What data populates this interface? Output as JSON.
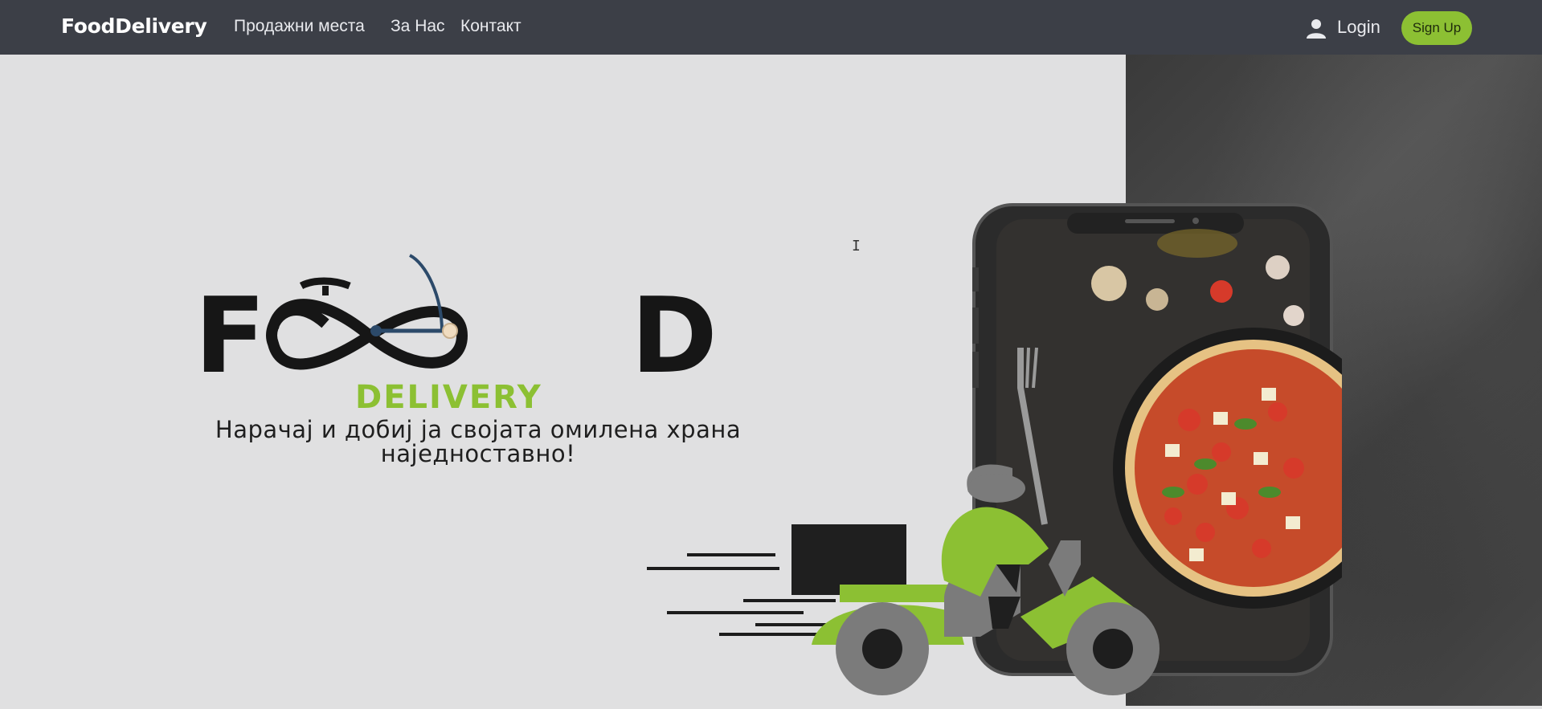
{
  "navbar": {
    "brand": "FoodDelivery",
    "links": [
      "Продажни места",
      "За Нас",
      "Контакт"
    ],
    "login_label": "Login",
    "signup_label": "Sign Up"
  },
  "hero": {
    "logo_text_left": "F",
    "logo_text_right": "D",
    "logo_subtitle": "DELIVERY",
    "tagline": "Нарачај и добиј ја својата омилена храна наједноставно!"
  },
  "colors": {
    "navbar_bg": "#3c3f47",
    "accent_green": "#8cc033",
    "hero_bg": "#e0e0e1"
  },
  "icons": [
    "user-icon",
    "text-cursor-icon"
  ]
}
